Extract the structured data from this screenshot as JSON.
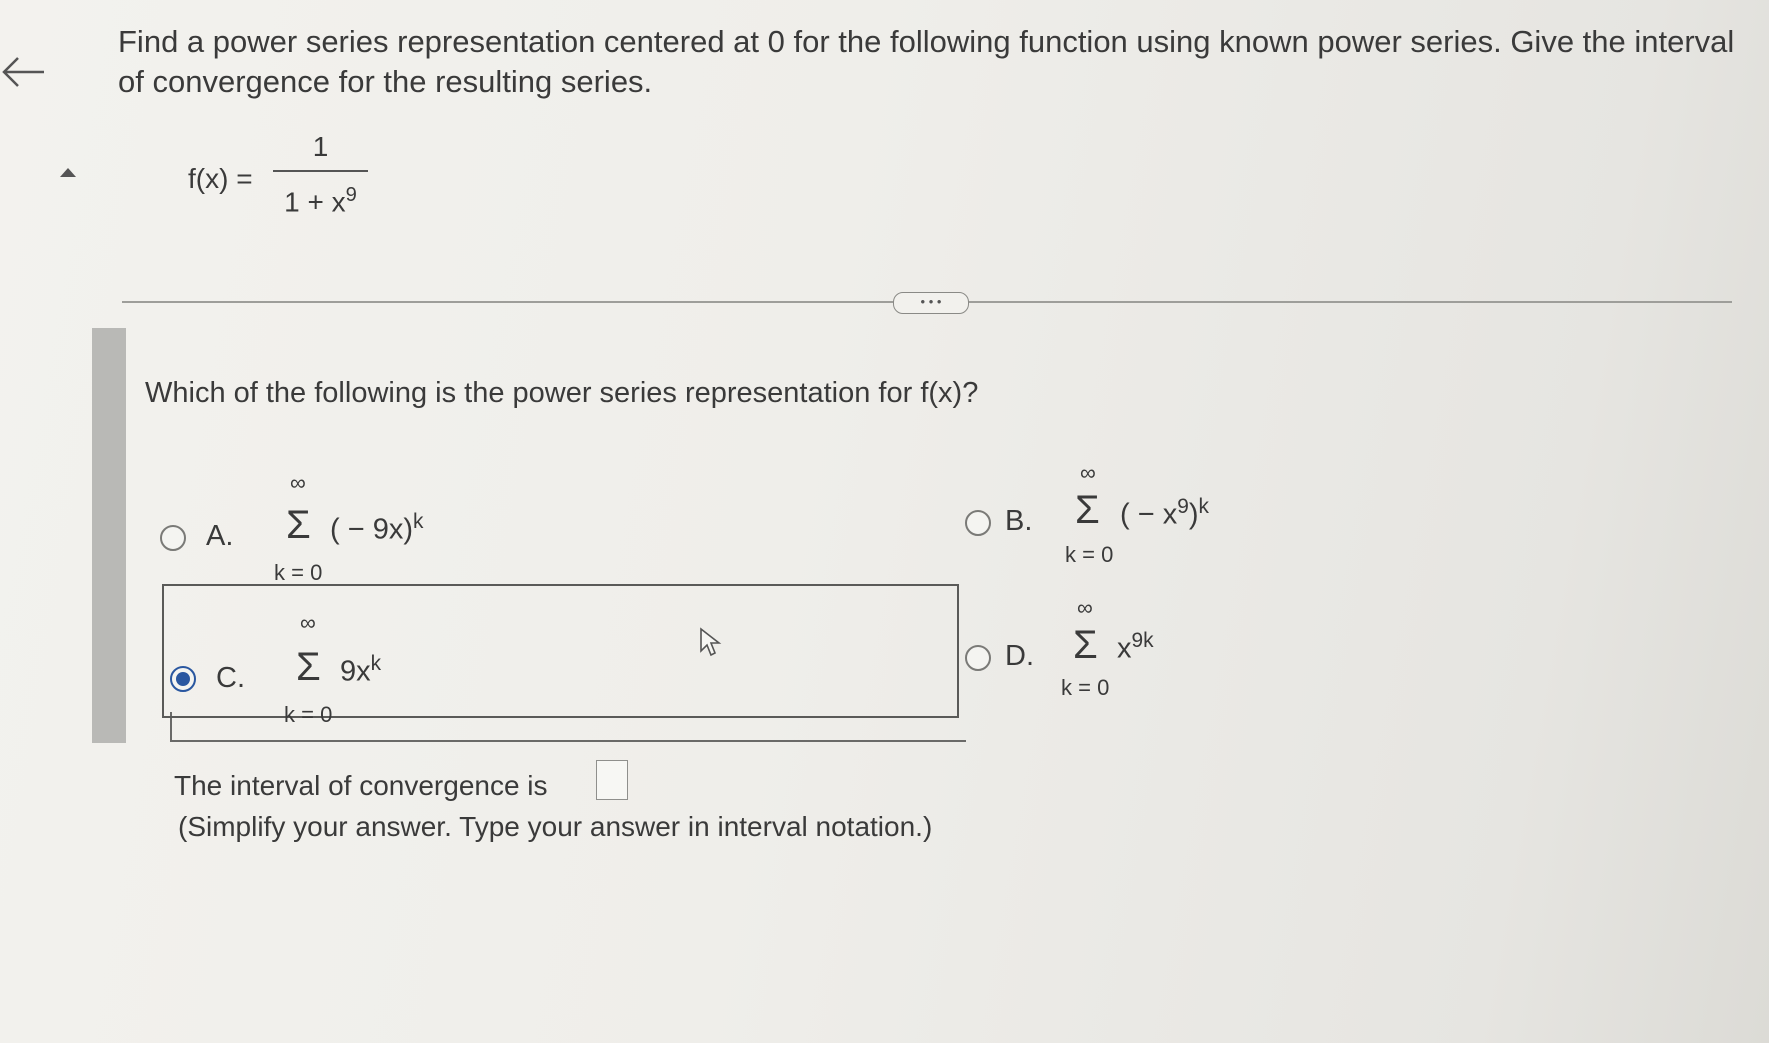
{
  "question": {
    "line1": "Find a power series representation centered at 0 for the following function using known power series. Give the interval",
    "line2": "of convergence for the resulting series."
  },
  "function": {
    "lhs": "f(x) =",
    "numerator": "1",
    "denominator_base": "1 + x",
    "denominator_exp": "9"
  },
  "more_button": "• • •",
  "prompt": "Which of the following is the power series representation for f(x)?",
  "options": [
    {
      "label": "A.",
      "upper": "∞",
      "sigma": "Σ",
      "lower": "k = 0",
      "term": "( − 9x)",
      "exponent": "k",
      "selected": false
    },
    {
      "label": "B.",
      "upper": "∞",
      "sigma": "Σ",
      "lower": "k = 0",
      "term": "( − x",
      "term_exp": "9",
      "term_close": ")",
      "exponent": "k",
      "selected": false
    },
    {
      "label": "C.",
      "upper": "∞",
      "sigma": "Σ",
      "lower": "k = 0",
      "term": "9x",
      "exponent": "k",
      "selected": true
    },
    {
      "label": "D.",
      "upper": "∞",
      "sigma": "Σ",
      "lower": "k = 0",
      "term": "x",
      "exponent": "9k",
      "selected": false
    }
  ],
  "interval": {
    "text": "The interval of convergence is",
    "value": "",
    "hint": "(Simplify your answer. Type your answer in interval notation.)"
  },
  "icons": {
    "back": "left-arrow-icon",
    "collapse": "triangle-up-icon",
    "cursor": "mouse-pointer-icon"
  },
  "colors": {
    "accent": "#2a57a0",
    "text": "#3a3a3a"
  }
}
